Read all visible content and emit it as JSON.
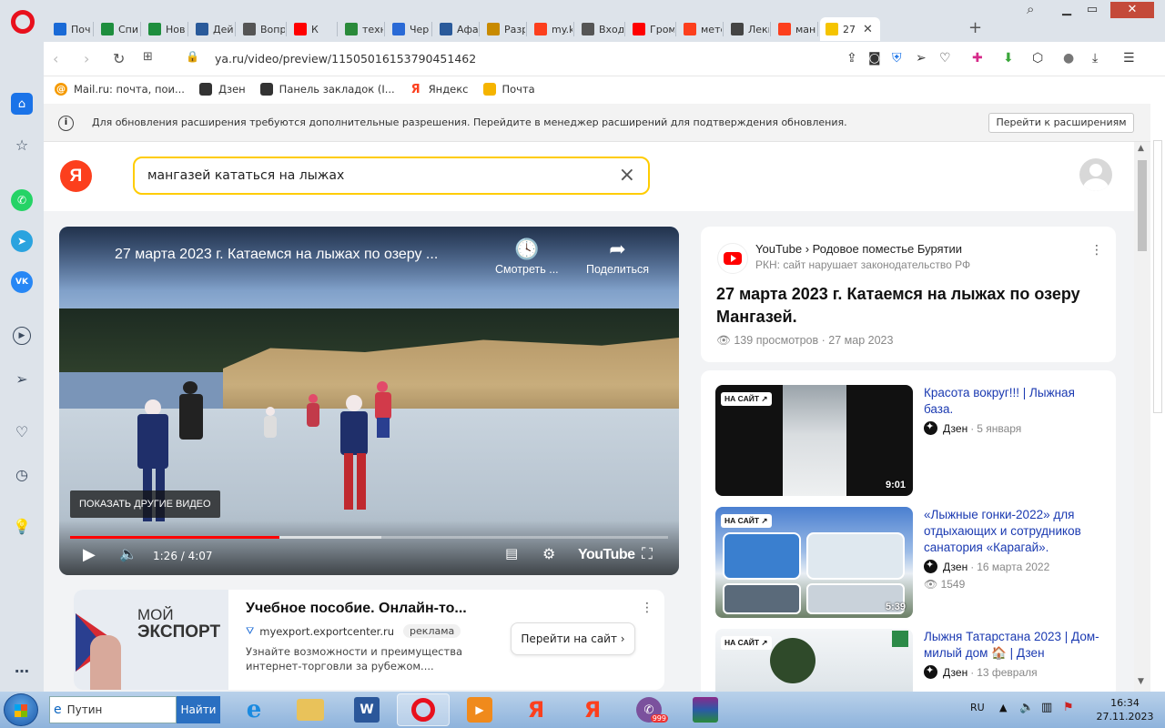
{
  "browser": {
    "tabs": [
      {
        "label": "Поч",
        "icon": "mail-icon",
        "color": "#1a6ad6"
      },
      {
        "label": "Спи",
        "icon": "sheet-icon",
        "color": "#1e8e3e"
      },
      {
        "label": "Нов",
        "icon": "sheet-icon",
        "color": "#1e8e3e"
      },
      {
        "label": "Дей",
        "icon": "book-icon",
        "color": "#2a5a9a"
      },
      {
        "label": "Вопр",
        "icon": "globe-icon",
        "color": "#555555"
      },
      {
        "label": "К",
        "icon": "youtube-icon",
        "color": "#ff0000"
      },
      {
        "label": "техн",
        "icon": "check-icon",
        "color": "#2a8a3a"
      },
      {
        "label": "Чер",
        "icon": "edge-icon",
        "color": "#2a6ad6"
      },
      {
        "label": "Афа",
        "icon": "book-icon",
        "color": "#2a5a9a"
      },
      {
        "label": "Разр",
        "icon": "warning-icon",
        "color": "#c88a00"
      },
      {
        "label": "my.k",
        "icon": "yandex-icon",
        "color": "#fc3f1d"
      },
      {
        "label": "Вход",
        "icon": "globe-icon",
        "color": "#555555"
      },
      {
        "label": "Гром",
        "icon": "youtube-icon",
        "color": "#ff0000"
      },
      {
        "label": "мете",
        "icon": "yandex-icon",
        "color": "#fc3f1d"
      },
      {
        "label": "Лекц",
        "icon": "pdf-icon",
        "color": "#444444"
      },
      {
        "label": "ман",
        "icon": "yandex-icon",
        "color": "#fc3f1d"
      },
      {
        "label": "27",
        "icon": "play-icon",
        "color": "#f5c400",
        "active": true
      }
    ],
    "url": "ya.ru/video/preview/11505016153790451462",
    "bookmarks": [
      {
        "label": "Mail.ru: почта, пои...",
        "icon": "mailru-icon"
      },
      {
        "label": "Дзен",
        "icon": "file-icon"
      },
      {
        "label": "Панель закладок (I...",
        "icon": "file-icon"
      },
      {
        "label": "Яндекс",
        "icon": "yandex-icon"
      },
      {
        "label": "Почта",
        "icon": "envelope-icon"
      }
    ],
    "notification": {
      "text": "Для обновления расширения требуются дополнительные разрешения. Перейдите в менеджер расширений для подтверждения обновления.",
      "button": "Перейти к расширениям"
    }
  },
  "page": {
    "logo": "Я",
    "search_value": "мангазей кататься на лыжах",
    "player": {
      "title": "27 марта 2023 г. Катаемся на лыжах по озеру ...",
      "watch_later": "Смотреть ...",
      "share": "Поделиться",
      "more_videos": "ПОКАЗАТЬ ДРУГИЕ ВИДЕО",
      "time": "1:26 / 4:07",
      "progress_fraction": 0.35,
      "buffer_fraction": 0.52,
      "brand": "YouTube"
    },
    "ad": {
      "logo_line1": "МОЙ",
      "logo_line2": "ЭКСПОРТ",
      "title": "Учебное пособие. Онлайн-то...",
      "domain": "myexport.exportcenter.ru",
      "tag": "реклама",
      "description": "Узнайте возможности и преимущества интернет-торговли за рубежом....",
      "button": "Перейти на сайт"
    },
    "info": {
      "source": "YouTube",
      "channel": "Родовое поместье Бурятии",
      "warning": "РКН: сайт нарушает законодательство РФ",
      "title": "27 марта 2023 г. Катаемся на лыжах по озеру Мангазей.",
      "views": "139 просмотров",
      "date": "27 мар 2023"
    },
    "related": [
      {
        "title": "Красота вокруг!!! | Лыжная база.",
        "source": "Дзен",
        "date": "5 января",
        "duration": "9:01",
        "badge": "НА САЙТ ↗",
        "views": ""
      },
      {
        "title": "«Лыжные гонки-2022» для отдыхающих и сотрудников санатория «Карагай».",
        "source": "Дзен",
        "date": "16 марта 2022",
        "duration": "5:39",
        "badge": "НА САЙТ ↗",
        "views": "1549"
      },
      {
        "title": "Лыжня Татарстана 2023 | Дом-милый дом 🏠 | Дзен",
        "source": "Дзен",
        "date": "13 февраля",
        "duration": "",
        "badge": "НА САЙТ ↗",
        "views": ""
      }
    ]
  },
  "taskbar": {
    "search_value": "Путин",
    "search_button": "Найти",
    "lang": "RU",
    "time": "16:34",
    "date": "27.11.2023",
    "viber_badge": "999"
  }
}
